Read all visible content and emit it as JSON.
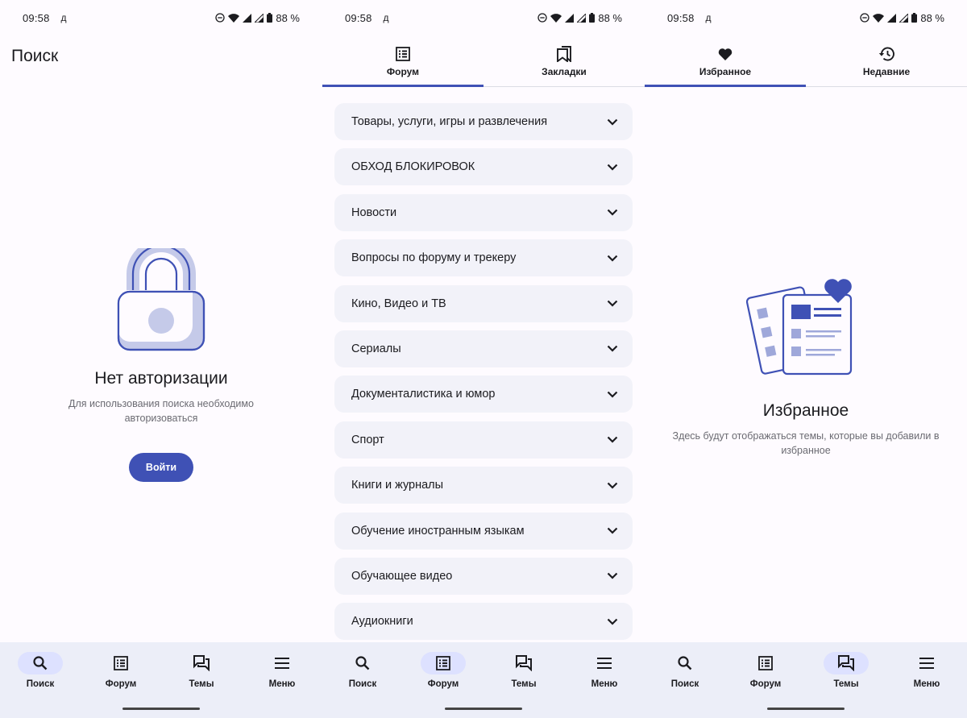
{
  "status": {
    "time": "09:58",
    "carrier": "д",
    "battery": "88 %"
  },
  "screen1": {
    "title": "Поиск",
    "empty_heading": "Нет авторизации",
    "empty_desc": "Для использования поиска необходимо авторизоваться",
    "login_label": "Войти"
  },
  "screen2": {
    "tabs": [
      "Форум",
      "Закладки"
    ],
    "forum_items": [
      "Товары, услуги, игры и развлечения",
      "ОБХОД БЛОКИРОВОК",
      "Новости",
      "Вопросы по форуму и трекеру",
      "Кино, Видео и ТВ",
      "Сериалы",
      "Документалистика и юмор",
      "Спорт",
      "Книги и журналы",
      "Обучение иностранным языкам",
      "Обучающее видео",
      "Аудиокниги"
    ]
  },
  "screen3": {
    "tabs": [
      "Избранное",
      "Недавние"
    ],
    "empty_heading": "Избранное",
    "empty_desc": "Здесь будут отображаться темы, которые вы добавили в избранное"
  },
  "nav": {
    "search": "Поиск",
    "forum": "Форум",
    "topics": "Темы",
    "menu": "Меню"
  },
  "colors": {
    "accent": "#3f51b5",
    "nav_bg": "#eceef8",
    "pill_active": "#dde1ff",
    "item_bg": "#f2f2f9"
  },
  "icons": [
    "search-icon",
    "forum-icon",
    "topics-icon",
    "menu-icon",
    "bookmarks-icon",
    "heart-icon",
    "history-icon",
    "lock-icon",
    "favorites-illustration-icon",
    "chevron-down-icon"
  ]
}
